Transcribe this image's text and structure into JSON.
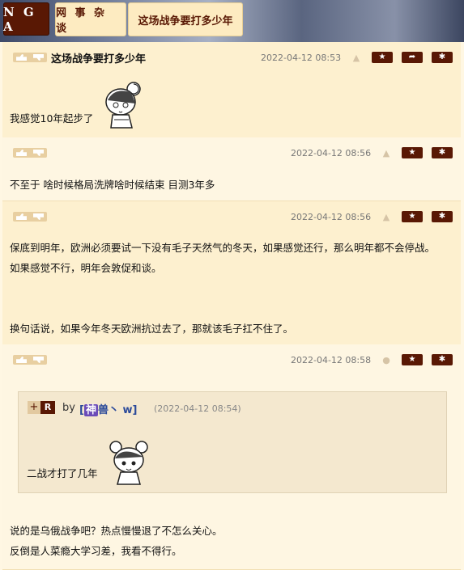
{
  "header": {
    "logo": "N G A",
    "breadcrumb": [
      "网 事 杂 谈",
      "这场战争要打多少年"
    ]
  },
  "posts": [
    {
      "title": "这场战争要打多少年",
      "date": "2022-04-12 08:53",
      "device": "android",
      "lines": [
        "我感觉10年起步了"
      ]
    },
    {
      "title": "",
      "date": "2022-04-12 08:56",
      "device": "android",
      "lines": [
        "不至于 啥时候格局洗牌啥时候结束 目测3年多"
      ]
    },
    {
      "title": "",
      "date": "2022-04-12 08:56",
      "device": "android",
      "lines": [
        "保底到明年，欧洲必须要试一下没有毛子天然气的冬天，如果感觉还行，那么明年都不会停战。",
        "如果感觉不行，明年会敦促和谈。",
        "换句话说，如果今年冬天欧洲抗过去了，那就该毛子扛不住了。"
      ]
    },
    {
      "title": "",
      "date": "2022-04-12 08:58",
      "device": "apple",
      "quote": {
        "plus": "+",
        "r": "R",
        "by": "by",
        "name_prefix": "[",
        "name_tag": "神",
        "name": "兽丶 w]",
        "date": "(2022-04-12 08:54)",
        "text": "二战才打了几年"
      },
      "lines": [
        "说的是乌俄战争吧？热点慢慢退了不怎么关心。",
        "反倒是人菜瘾大学习差，我看不得行。"
      ]
    }
  ],
  "icons": {
    "star": "★",
    "share": "➦",
    "gear": "✱"
  },
  "colors": {
    "brand": "#591804",
    "crumb_bg": "#fdebc1",
    "post_even": "#fdf0cf",
    "post_odd": "#fef6e2"
  }
}
